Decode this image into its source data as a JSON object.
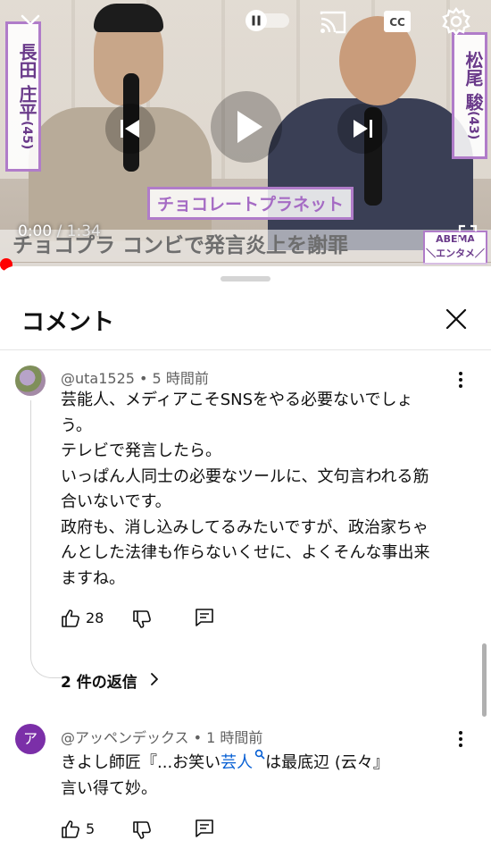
{
  "video": {
    "name_left": "長田 庄平",
    "age_left": "(45)",
    "name_right": "松尾 駿",
    "age_right": "(43)",
    "caption_band": "チョコレートプラネット",
    "headline": "チョコプラ コンビで発言炎上を謝罪",
    "abema_line1": "ABEMA",
    "abema_line2": "＼エンタメ／",
    "time_current": "0:00",
    "time_separator": " / ",
    "time_total": "1:34",
    "progress_fraction": 0.0,
    "icons": [
      "chevron-down-icon",
      "pause-icon",
      "cast-icon",
      "closed-captions-icon",
      "settings-gear-icon",
      "previous-icon",
      "play-icon",
      "next-icon",
      "fullscreen-icon"
    ]
  },
  "comments_panel": {
    "title": "コメント",
    "comments": [
      {
        "author": "@uta1525",
        "separator": " • ",
        "time": "5 時間前",
        "body": "芸能人、メディアこそSNSをやる必要ないでしょ\nう。\nテレビで発言したら。\nいっぱん人同士の必要なツールに、文句言われる筋\n合いないです。\n政府も、消し込みしてるみたいですが、政治家ちゃ\nんとした法律も作らないくせに、よくそんな事出来\nますね。",
        "likes": "28",
        "replies_label": "2 件の返信"
      },
      {
        "author": "@アッペンデックス",
        "separator": " • ",
        "time": "1 時間前",
        "avatar_letter": "ア",
        "body_prefix": "きよし師匠『...お笑い",
        "body_link": "芸人",
        "body_suffix": "は最底辺 (云々』\n言い得て妙。",
        "likes": "5"
      }
    ]
  },
  "colors": {
    "accent_red": "#ff0000",
    "link_blue": "#065fd4",
    "avatar_purple": "#7b2fa8",
    "caption_purple": "#b07cc9"
  }
}
